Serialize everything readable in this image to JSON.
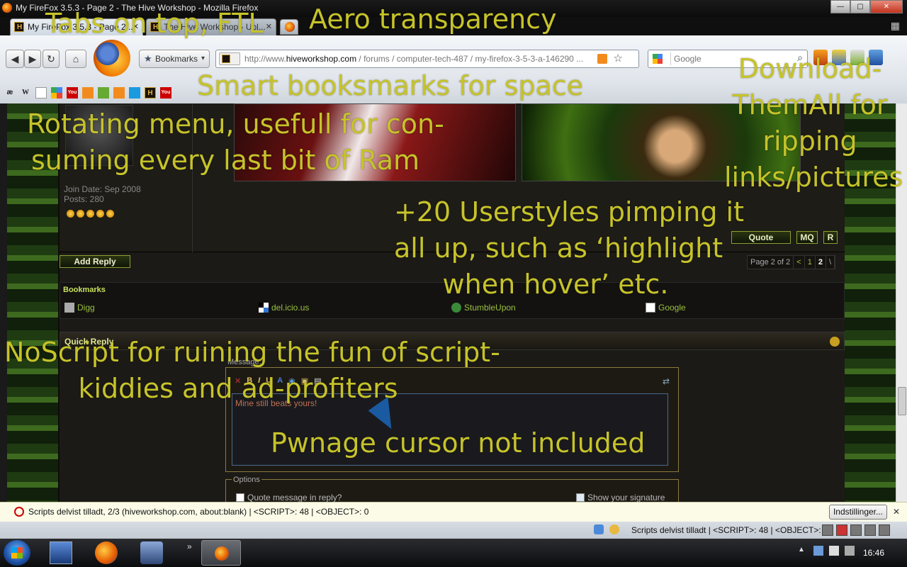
{
  "window": {
    "title": "My FireFox 3.5.3 - Page 2 - The Hive Workshop - Mozilla Firefox",
    "buttons": {
      "minimize": "—",
      "maximize": "▢",
      "close": "✕"
    }
  },
  "tabs": [
    {
      "label": "My FireFox 3.5.3 - Page 2 ...",
      "close": "✕"
    },
    {
      "label": "The Hive Workshop - Upl...",
      "close": "✕"
    }
  ],
  "toolbar": {
    "back": "◀",
    "forward": "▶",
    "reload": "↻",
    "home": "⌂",
    "bookmarks_label": "Bookmarks",
    "url_prefix": "http://www.",
    "url_domain": "hiveworkshop.com",
    "url_rest": " / forums / computer-tech-487 / my-firefox-3-5-3-a-146290 ...",
    "search_placeholder": "Google",
    "search_icon": "search-icon"
  },
  "bookmarks_toolbar": [
    "æ",
    "W",
    "▢",
    "G",
    "You",
    "rss",
    "m",
    "rss",
    "▪",
    "H",
    "You"
  ],
  "post": {
    "join_date": "Join Date: Sep 2008",
    "posts": "Posts: 280",
    "quote_label": "Quote",
    "mq_label": "MQ",
    "r_label": "R"
  },
  "add_reply_label": "Add Reply",
  "page_nav": {
    "label": "Page 2 of 2",
    "prev": "<",
    "p1": "1",
    "p2": "2",
    "last": "\\"
  },
  "bookmarks_box": {
    "heading": "Bookmarks",
    "links": [
      "Digg",
      "del.icio.us",
      "StumbleUpon",
      "Google"
    ]
  },
  "quick_reply": {
    "heading": "Quick Reply",
    "message_label": "Message:",
    "format_buttons": [
      "B",
      "I",
      "U",
      "A"
    ],
    "message_text": "Mine still beats yours!",
    "options_label": "Options",
    "quote_option": "Quote message in reply?",
    "signature_option": "Show your signature"
  },
  "noscript_bar": {
    "text": "Scripts delvist tilladt, 2/3 (hiveworkshop.com, about:blank) | <SCRIPT>: 48 | <OBJECT>: 0",
    "button": "Indstillinger...",
    "close": "✕"
  },
  "status_bar": {
    "text": "Scripts delvist tilladt | <SCRIPT>: 48 | <OBJECT>: 0"
  },
  "taskbar": {
    "clock": "16:46",
    "overflow": "»"
  },
  "annotations": {
    "tabs_on_top": "Tabs on top, FTL",
    "aero": "Aero transparency",
    "smart_bookmarks": "Smart booksmarks for space",
    "download_l1": "Download-",
    "download_l2": "ThemAll for",
    "download_l3": "ripping",
    "download_l4": "links/pictures",
    "rotating_l1": "Rotating menu, usefull for con-",
    "rotating_l2": "suming every last bit of Ram",
    "userstyles_l1": "+20 Userstyles pimping it",
    "userstyles_l2": "all up, such as ‘highlight",
    "userstyles_l3": "when hover’ etc.",
    "noscript_l1": "NoScript for ruining the fun of script-",
    "noscript_l2": "kiddies and ad-profiters",
    "cursor": "Pwnage cursor not included"
  },
  "colors": {
    "annotation": "#c6c32a",
    "forum_bg": "#1c1a16",
    "link_green": "#9ac040",
    "noscript_bar": "#fbfbe8"
  }
}
